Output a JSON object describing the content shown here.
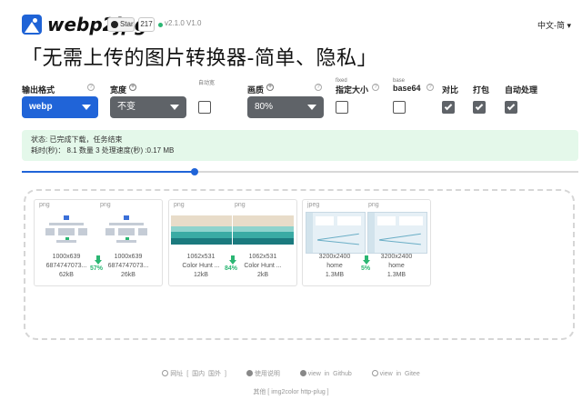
{
  "header": {
    "brand": "webp2jpg",
    "github_star_label": "Star",
    "github_star_count": "217",
    "version": "v2.1.0  V1.0",
    "language": "中文-简 ▾"
  },
  "title": "「无需上传的图片转换器-简单、隐私」",
  "options": {
    "format": {
      "label": "输出格式",
      "value": "webp"
    },
    "width": {
      "label": "宽度",
      "value": "不变"
    },
    "auto_width": {
      "label": "自动宽",
      "checked": false
    },
    "quality": {
      "label": "画质",
      "value": "80%"
    },
    "fixed_size": {
      "label": "指定大小",
      "hint": "fixed",
      "checked": false
    },
    "base64": {
      "label": "base64",
      "hint": "base",
      "checked": false
    },
    "compare": {
      "label": "对比",
      "checked": true
    },
    "pack": {
      "label": "打包",
      "checked": true
    },
    "auto_process": {
      "label": "自动处理",
      "checked": true
    }
  },
  "status": {
    "line1": "状态: 已完成下载，任务结束",
    "line2": "耗时(秒)： 8.1 数量 3 处理速度(秒) :0.17 MB"
  },
  "slider": {
    "fill": 0.31
  },
  "cards": [
    {
      "input": {
        "format": "png",
        "dims": "1000x639",
        "name": "6874747073...",
        "size": "62kB"
      },
      "output": {
        "format": "png",
        "dims": "1000x639",
        "name": "6874747073...",
        "size": "26kB"
      },
      "ratio": "57%"
    },
    {
      "input": {
        "format": "png",
        "dims": "1062x531",
        "name": "Color Hunt ...",
        "size": "12kB"
      },
      "output": {
        "format": "png",
        "dims": "1062x531",
        "name": "Color Hunt ...",
        "size": "2kB"
      },
      "ratio": "84%"
    },
    {
      "input": {
        "format": "jpeg",
        "dims": "3200x2400",
        "name": "home",
        "size": "1.3MB"
      },
      "output": {
        "format": "png",
        "dims": "3200x2400",
        "name": "home",
        "size": "1.3MB"
      },
      "ratio": "5%"
    }
  ],
  "footer": {
    "site_label": "网址 [ 国内 国外 ]",
    "help_label": "使用说明",
    "github_label": "view in Github",
    "gitee_label": "view in Gitee",
    "others_label": "其他 [ img2color   http-plug ]"
  },
  "colors": {
    "accent": "#2064d8",
    "select_gray": "#5f6368",
    "status_bg": "#e4f8ea",
    "success_green": "#2bb673",
    "palette_bands": [
      "#e8dcc9",
      "#e8dcc9",
      "#8fd3cd",
      "#3aaba4",
      "#1b7a7e"
    ]
  },
  "icons": [
    "logo-icon",
    "github-icon",
    "help-icon",
    "plus-circle-icon",
    "down-arrow-icon",
    "site-icon",
    "question-icon",
    "github-icon",
    "gitee-icon"
  ]
}
